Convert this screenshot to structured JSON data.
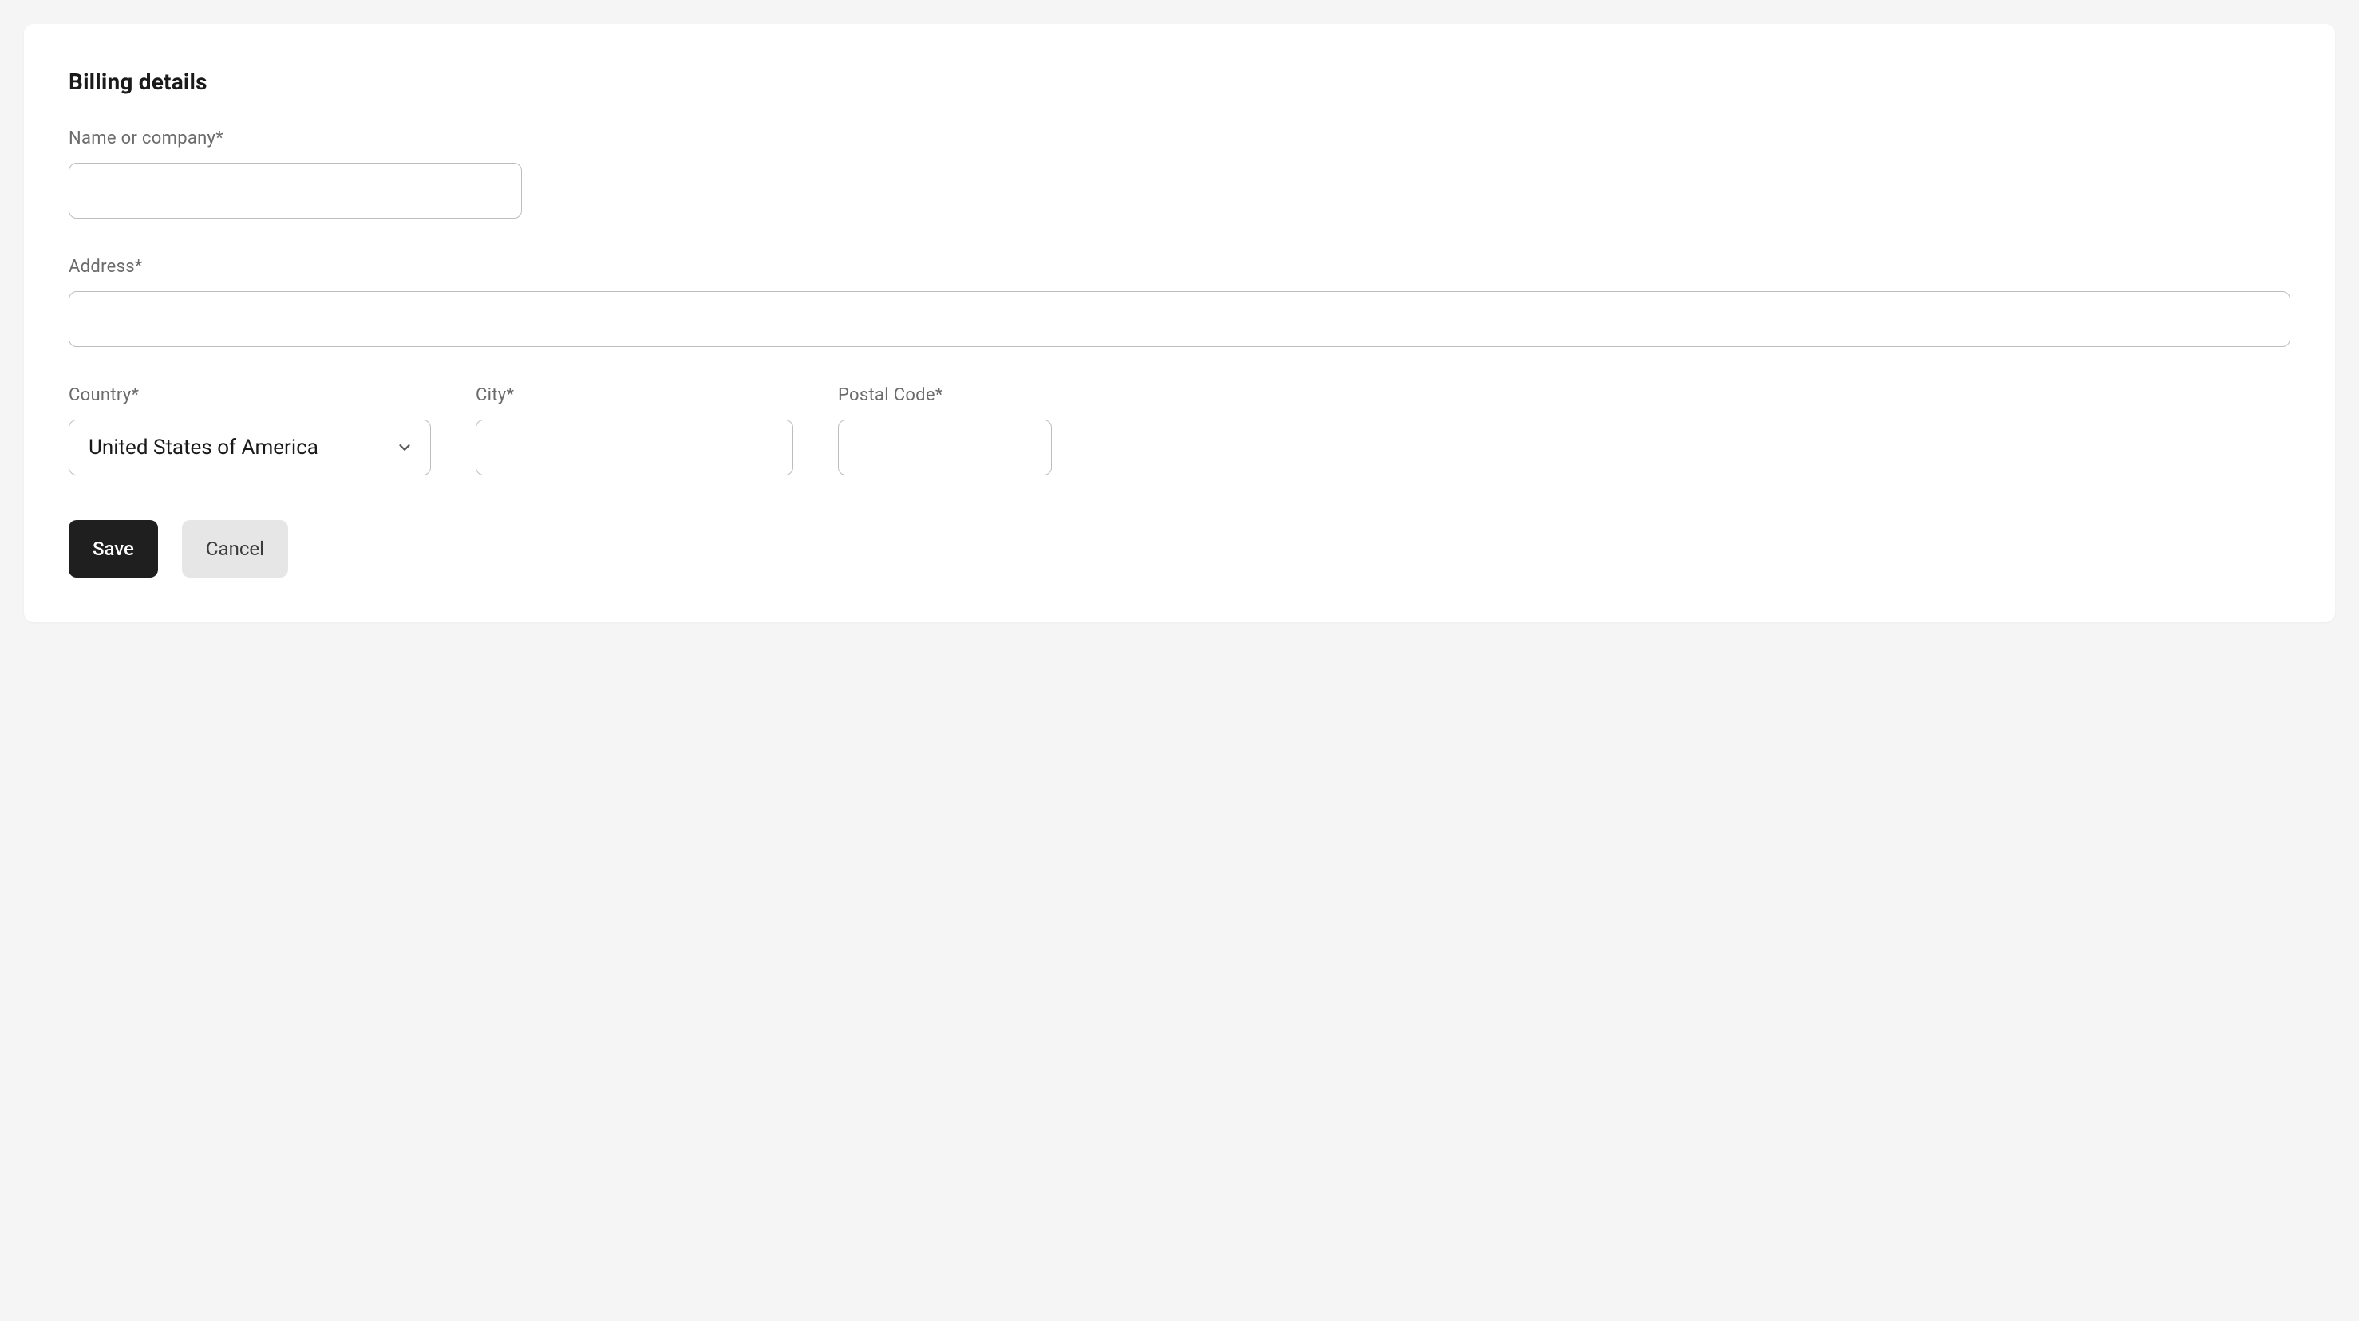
{
  "form": {
    "title": "Billing details",
    "fields": {
      "name": {
        "label": "Name or company*",
        "value": ""
      },
      "address": {
        "label": "Address*",
        "value": ""
      },
      "country": {
        "label": "Country*",
        "value": "United States of America"
      },
      "city": {
        "label": "City*",
        "value": ""
      },
      "postal": {
        "label": "Postal Code*",
        "value": ""
      }
    },
    "buttons": {
      "save": "Save",
      "cancel": "Cancel"
    }
  }
}
